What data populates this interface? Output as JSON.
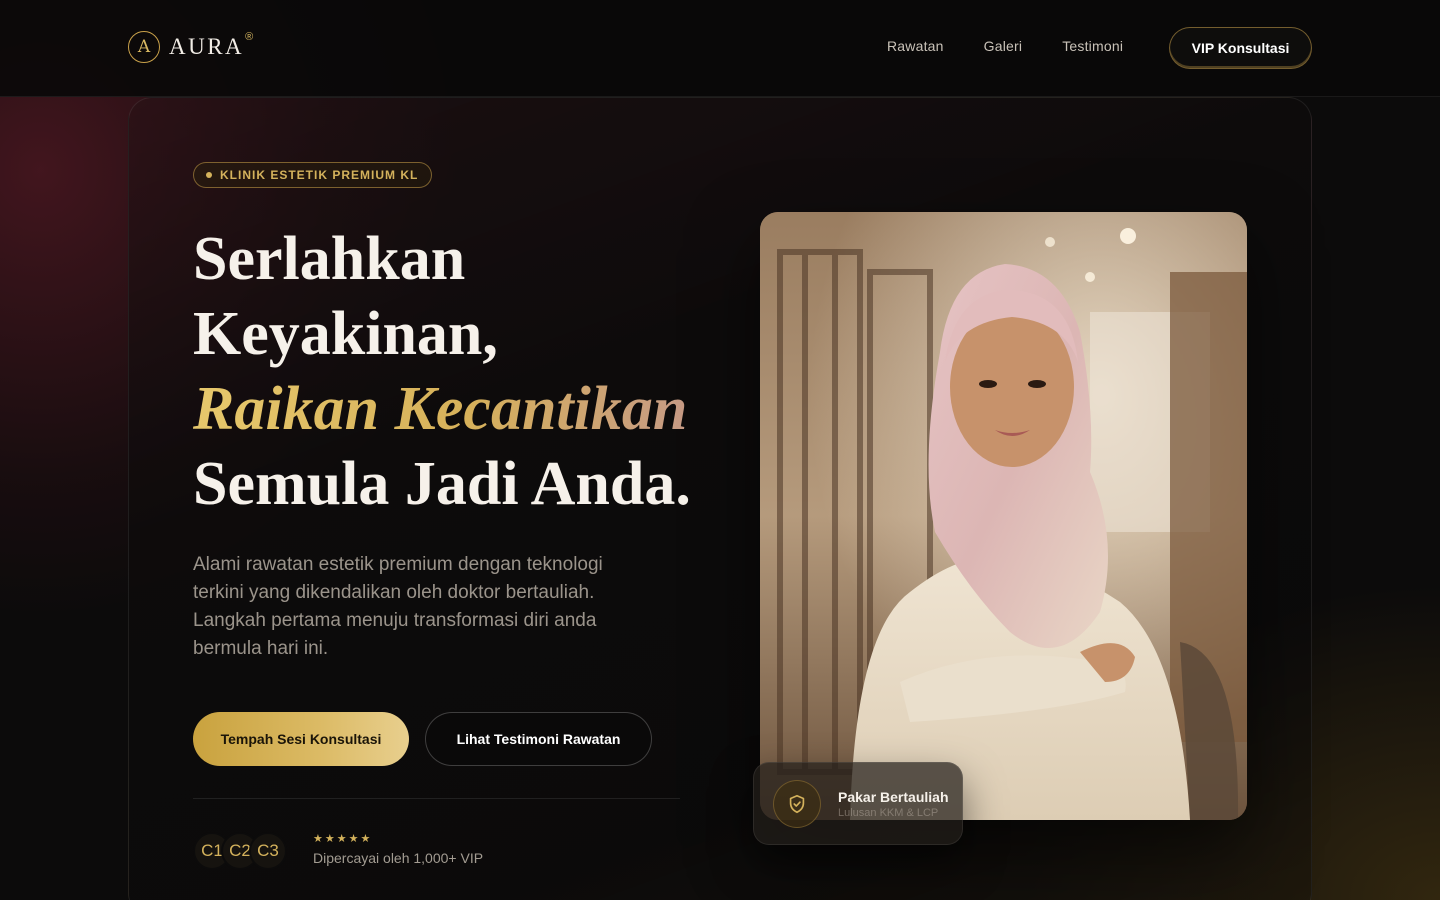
{
  "brand": {
    "mark": "A",
    "name": "AURA",
    "reg": "®"
  },
  "nav": {
    "items": [
      "Rawatan",
      "Galeri",
      "Testimoni"
    ],
    "cta": "VIP Konsultasi"
  },
  "hero": {
    "badge": "KLINIK ESTETIK PREMIUM KL",
    "headline": [
      "Serlahkan",
      "Keyakinan,",
      "Raikan Kecantikan",
      "Semula Jadi Anda."
    ],
    "description": "Alami rawatan estetik premium dengan teknologi terkini yang dikendalikan oleh doktor bertauliah. Langkah pertama menuju transformasi diri anda bermula hari ini.",
    "primary_cta": "Tempah Sesi Konsultasi",
    "secondary_cta": "Lihat Testimoni Rawatan",
    "avatars": [
      "C1",
      "C2",
      "C3"
    ],
    "rating_stars": "★★★★★",
    "trust_text": "Dipercayai oleh 1,000+ VIP"
  },
  "expert_card": {
    "title": "Pakar Bertauliah",
    "subtitle": "Lulusan KKM & LCP"
  },
  "colors": {
    "gold": "#d4b25c",
    "background": "#0c0b0b",
    "burgundy": "#6e1e2d"
  },
  "icons": {
    "expert": "shield-check-icon"
  }
}
